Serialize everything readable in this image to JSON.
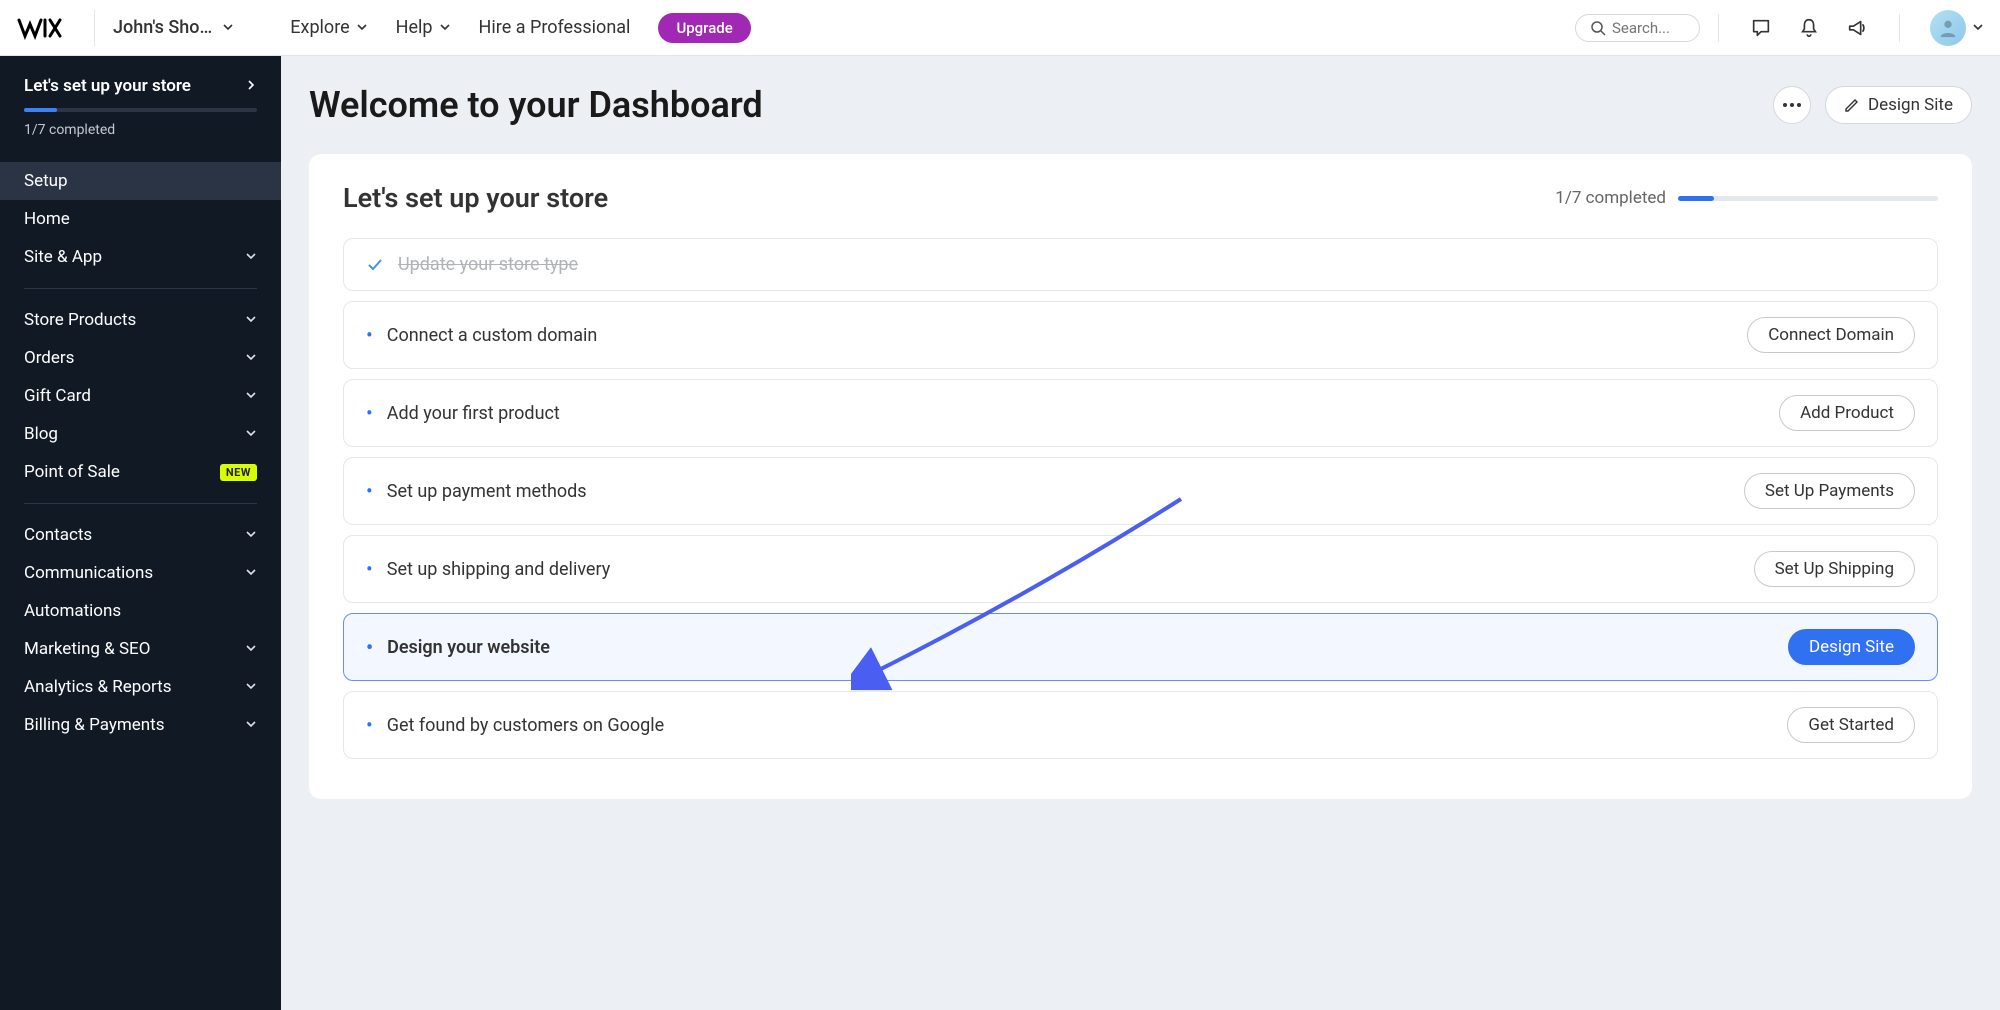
{
  "topbar": {
    "site_name": "John's Sho…",
    "explore": "Explore",
    "help": "Help",
    "hire": "Hire a Professional",
    "upgrade": "Upgrade",
    "search_placeholder": "Search..."
  },
  "sidebar": {
    "progress_title": "Let's set up your store",
    "progress_sub": "1/7 completed",
    "nav": {
      "setup": "Setup",
      "home": "Home",
      "site_app": "Site & App",
      "store_products": "Store Products",
      "orders": "Orders",
      "gift_card": "Gift Card",
      "blog": "Blog",
      "point_of_sale": "Point of Sale",
      "new_badge": "NEW",
      "contacts": "Contacts",
      "communications": "Communications",
      "automations": "Automations",
      "marketing": "Marketing & SEO",
      "analytics": "Analytics & Reports",
      "billing": "Billing & Payments"
    }
  },
  "main": {
    "title": "Welcome to your Dashboard",
    "design_site": "Design Site"
  },
  "card": {
    "title": "Let's set up your store",
    "progress_label": "1/7 completed",
    "tasks": {
      "t1": "Update your store type",
      "t2": "Connect a custom domain",
      "t2_btn": "Connect Domain",
      "t3": "Add your first product",
      "t3_btn": "Add Product",
      "t4": "Set up payment methods",
      "t4_btn": "Set Up Payments",
      "t5": "Set up shipping and delivery",
      "t5_btn": "Set Up Shipping",
      "t6": "Design your website",
      "t6_btn": "Design Site",
      "t7": "Get found by customers on Google",
      "t7_btn": "Get Started"
    }
  }
}
